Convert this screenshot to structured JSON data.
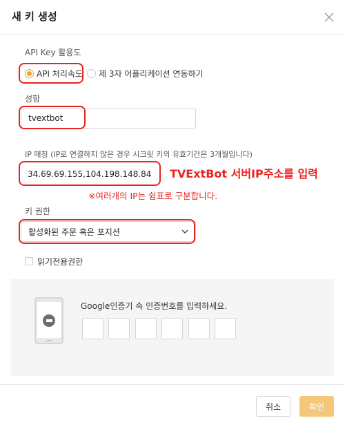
{
  "dialog": {
    "title": "새 키 생성",
    "close_icon": "close-icon"
  },
  "usage": {
    "label": "API Key 활용도",
    "options": [
      {
        "label": "API 처리속도",
        "selected": true
      },
      {
        "label": "제 3자 어플리케이션 연동하기",
        "selected": false
      }
    ]
  },
  "name_field": {
    "label": "성함",
    "value": "tvextbot"
  },
  "ip_field": {
    "label": "IP 매칭 (IP로 연결하지 않은 경우 시크릿 키의 유효기간은 3개월입니다)",
    "value": "34.69.69.155,104.198.148.84"
  },
  "annotation": {
    "main": "TVExtBot 서버IP주소를 입력",
    "sub": "※여러개의 IP는 쉼표로 구분합니다.",
    "color": "#e8241f"
  },
  "permission": {
    "label": "키 권한",
    "selected": "활성화된 주문 혹은 포지션"
  },
  "readonly": {
    "label": "읽기전용권한",
    "checked": false
  },
  "otp": {
    "label": "Google인증기 속 인증번호를 입력하세요.",
    "icon": "phone-icon",
    "digits": [
      "",
      "",
      "",
      "",
      "",
      ""
    ]
  },
  "footer": {
    "cancel_label": "취소",
    "confirm_label": "확인"
  },
  "colors": {
    "accent": "#f0a21e",
    "confirm_button": "#f5c77a",
    "highlight": "#e8241f"
  }
}
